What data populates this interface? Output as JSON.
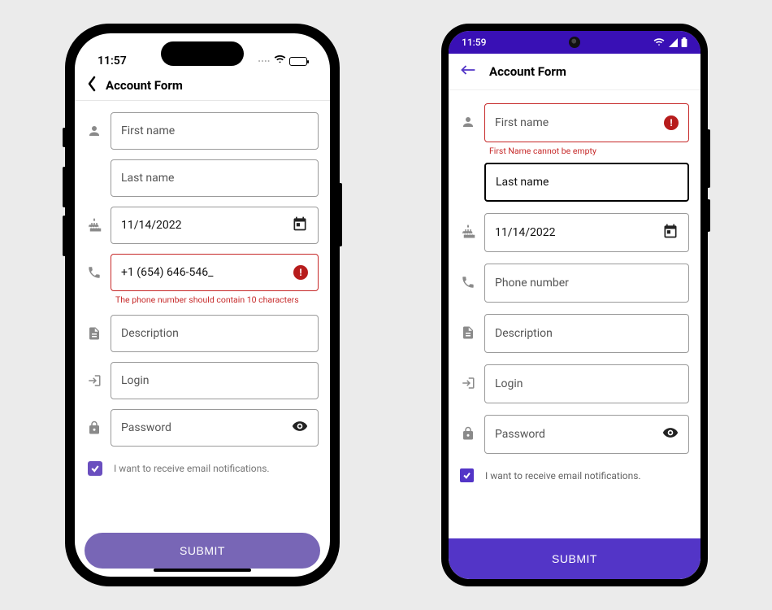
{
  "ios": {
    "status_time": "11:57",
    "nav_title": "Account Form",
    "first_name_ph": "First name",
    "last_name_ph": "Last name",
    "date_value": "11/14/2022",
    "phone_value": "+1 (654) 646-546_",
    "phone_error": "The phone number should contain 10 characters",
    "desc_ph": "Description",
    "login_ph": "Login",
    "pwd_ph": "Password",
    "check_label": "I want to receive email notifications.",
    "submit_label": "SUBMIT"
  },
  "and": {
    "status_time": "11:59",
    "nav_title": "Account Form",
    "first_name_ph": "First name",
    "first_name_error": "First Name cannot be empty",
    "last_name_ph": "Last name",
    "date_value": "11/14/2022",
    "phone_ph": "Phone number",
    "desc_ph": "Description",
    "login_ph": "Login",
    "pwd_ph": "Password",
    "check_label": "I want to receive email notifications.",
    "submit_label": "SUBMIT"
  }
}
